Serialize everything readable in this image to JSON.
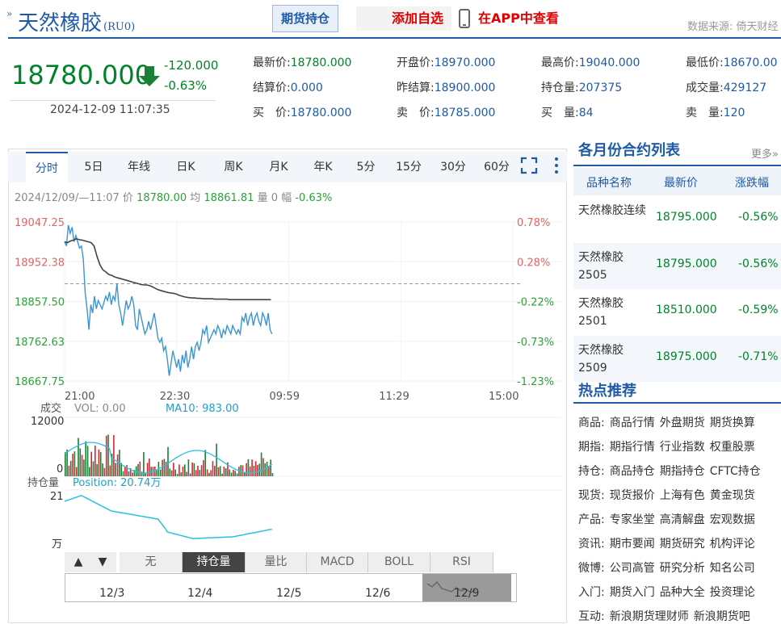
{
  "header": {
    "title": "天然橡胶",
    "code": "(RU0)",
    "positions_btn": "期货持仓",
    "add_fav": "添加自选",
    "view_app": "在APP中查看",
    "source": "数据来源: 倚天财经"
  },
  "quote": {
    "price": "18780.000",
    "change": "-120.000",
    "change_pct": "-0.63%",
    "timestamp": "2024-12-09 11:07:35"
  },
  "fields": [
    {
      "label": "最新价:",
      "value": "18780.000"
    },
    {
      "label": "开盘价:",
      "value": "18970.000"
    },
    {
      "label": "最高价:",
      "value": "19040.000"
    },
    {
      "label": "最低价:",
      "value": "18670.00"
    },
    {
      "label": "结算价:",
      "value": "0.000"
    },
    {
      "label": "昨结算:",
      "value": "18900.000"
    },
    {
      "label": "持仓量:",
      "value": "207375"
    },
    {
      "label": "成交量:",
      "value": "429127"
    },
    {
      "label": "买　价:",
      "value": "18780.000"
    },
    {
      "label": "卖　价:",
      "value": "18785.000"
    },
    {
      "label": "买　量:",
      "value": "84"
    },
    {
      "label": "卖　量:",
      "value": "120"
    }
  ],
  "tabs": [
    "分时",
    "5日",
    "年线",
    "日K",
    "周K",
    "月K",
    "年K",
    "5分",
    "15分",
    "30分",
    "60分"
  ],
  "chart_info": {
    "time": "2024/12/09/—11:07",
    "price_label": "价",
    "price": "18780.00",
    "avg_label": "均",
    "avg": "18861.81",
    "vol_label": "量",
    "vol": "0",
    "amp_label": "幅",
    "amp": "-0.63%"
  },
  "chart_data": {
    "type": "line",
    "y_ticks": [
      "19047.25",
      "18952.38",
      "18857.50",
      "18762.63",
      "18667.75"
    ],
    "pct_ticks": [
      "0.78%",
      "0.28%",
      "-0.22%",
      "-0.73%",
      "-1.23%"
    ],
    "x_ticks": [
      "21:00",
      "22:30",
      "09:59",
      "11:29",
      "15:00"
    ],
    "ylim": [
      18667.75,
      19047.25
    ],
    "ref_price": 18900,
    "price": [
      19000,
      18990,
      19040,
      19020,
      19035,
      19000,
      19015,
      19000,
      18985,
      18990,
      18960,
      18880,
      18840,
      18790,
      18850,
      18830,
      18870,
      18840,
      18860,
      18850,
      18840,
      18855,
      18870,
      18860,
      18880,
      18850,
      18870,
      18860,
      18900,
      18850,
      18830,
      18800,
      18830,
      18860,
      18840,
      18850,
      18870,
      18850,
      18800,
      18790,
      18840,
      18820,
      18800,
      18780,
      18790,
      18810,
      18790,
      18810,
      18830,
      18800,
      18770,
      18760,
      18770,
      18740,
      18750,
      18720,
      18680,
      18710,
      18740,
      18720,
      18700,
      18720,
      18690,
      18730,
      18710,
      18740,
      18700,
      18720,
      18750,
      18720,
      18750,
      18760,
      18740,
      18760,
      18790,
      18780,
      18800,
      18760,
      18770,
      18780,
      18790,
      18780,
      18800,
      18790,
      18770,
      18790,
      18780,
      18800,
      18790,
      18780,
      18800,
      18790,
      18780,
      18790,
      18780,
      18820,
      18810,
      18830,
      18800,
      18820,
      18830,
      18800,
      18820,
      18830,
      18810,
      18800,
      18830,
      18820,
      18800,
      18830,
      18790,
      18780
    ],
    "avg": [
      19000,
      18998,
      19002,
      19004,
      19007,
      19005,
      19004,
      19002,
      19000,
      18998,
      18990,
      18965,
      18945,
      18933,
      18928,
      18922,
      18920,
      18916,
      18914,
      18912,
      18910,
      18908,
      18906,
      18904,
      18902,
      18900,
      18898,
      18897,
      18897,
      18895,
      18892,
      18888,
      18885,
      18883,
      18881,
      18879,
      18878,
      18877,
      18875,
      18872,
      18870,
      18868,
      18867,
      18866,
      18866,
      18865,
      18865,
      18864,
      18864,
      18864,
      18864,
      18863,
      18863,
      18863,
      18863,
      18863,
      18862,
      18862,
      18862,
      18862,
      18862,
      18862,
      18862,
      18862,
      18862,
      18862,
      18862,
      18862,
      18862,
      18862,
      18862
    ],
    "volume_label": "成交",
    "vol_text": "VOL: 0.00",
    "ma10_text": "MA10: 983.00",
    "vol_max": "12000",
    "vol_min": "0",
    "oi_label": "持仓量",
    "oi_text": "Position: 20.74万",
    "oi_max": "21",
    "oi_unit": "万"
  },
  "indicator_tabs": [
    "无",
    "持仓量",
    "量比",
    "MACD",
    "BOLL",
    "RSI"
  ],
  "range_dates": [
    "12/3",
    "12/4",
    "12/5",
    "12/6",
    "12/9"
  ],
  "right": {
    "title": "各月份合约列表",
    "more": "更多»",
    "cols": [
      "品种名称",
      "最新价",
      "涨跌幅"
    ],
    "rows": [
      {
        "name": "天然橡胶连续",
        "price": "18795.000",
        "chg": "-0.56%"
      },
      {
        "name": "天然橡胶2505",
        "price": "18795.000",
        "chg": "-0.56%"
      },
      {
        "name": "天然橡胶2501",
        "price": "18510.000",
        "chg": "-0.59%"
      },
      {
        "name": "天然橡胶2509",
        "price": "18975.000",
        "chg": "-0.71%"
      }
    ],
    "hot_title": "热点推荐",
    "hot": [
      {
        "k": "商品:",
        "items": [
          "商品行情",
          "外盘期货",
          "期货换算"
        ]
      },
      {
        "k": "期指:",
        "items": [
          "期指行情",
          "行业指数",
          "权重股票"
        ]
      },
      {
        "k": "持仓:",
        "items": [
          "商品持仓",
          "期指持仓",
          "CFTC持仓"
        ]
      },
      {
        "k": "现货:",
        "items": [
          "现货报价",
          "上海有色",
          "黄金现货"
        ]
      },
      {
        "k": "产品:",
        "items": [
          "专家坐堂",
          "高清解盘",
          "宏观数据"
        ]
      },
      {
        "k": "资讯:",
        "items": [
          "期市要闻",
          "期货研究",
          "机构评论"
        ]
      },
      {
        "k": "微博:",
        "items": [
          "公司高管",
          "研究分析",
          "知名公司"
        ]
      },
      {
        "k": "入门:",
        "items": [
          "期货入门",
          "品种大全",
          "投资理论"
        ]
      },
      {
        "k": "互动:",
        "items": [
          "新浪期货理财师",
          "新浪期货吧"
        ]
      }
    ]
  }
}
